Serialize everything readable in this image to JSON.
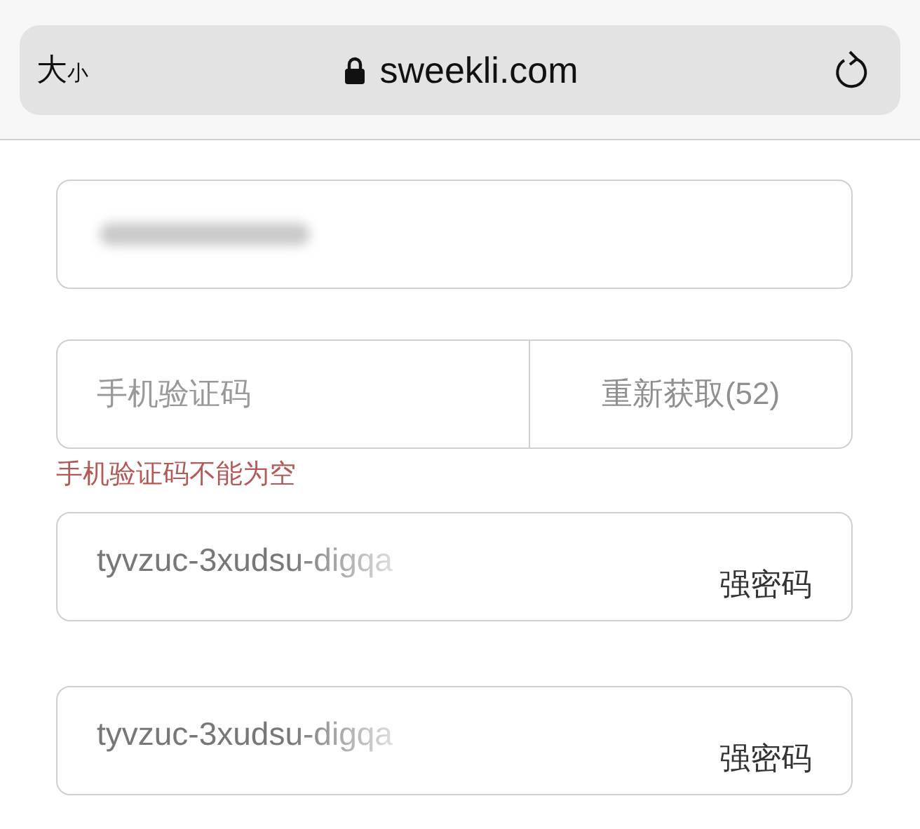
{
  "browser_bar": {
    "text_size_button": {
      "large": "大",
      "small": "小"
    },
    "url": "sweekli.com",
    "secure": true
  },
  "phone_field": {
    "redacted": true
  },
  "code_field": {
    "placeholder": "手机验证码",
    "resend_button": "重新获取(52)",
    "error": "手机验证码不能为空"
  },
  "password_fields": [
    {
      "value": "tyvzuc-3xudsu-digqa",
      "badge": "强密码"
    },
    {
      "value": "tyvzuc-3xudsu-digqa",
      "badge": "强密码"
    }
  ]
}
